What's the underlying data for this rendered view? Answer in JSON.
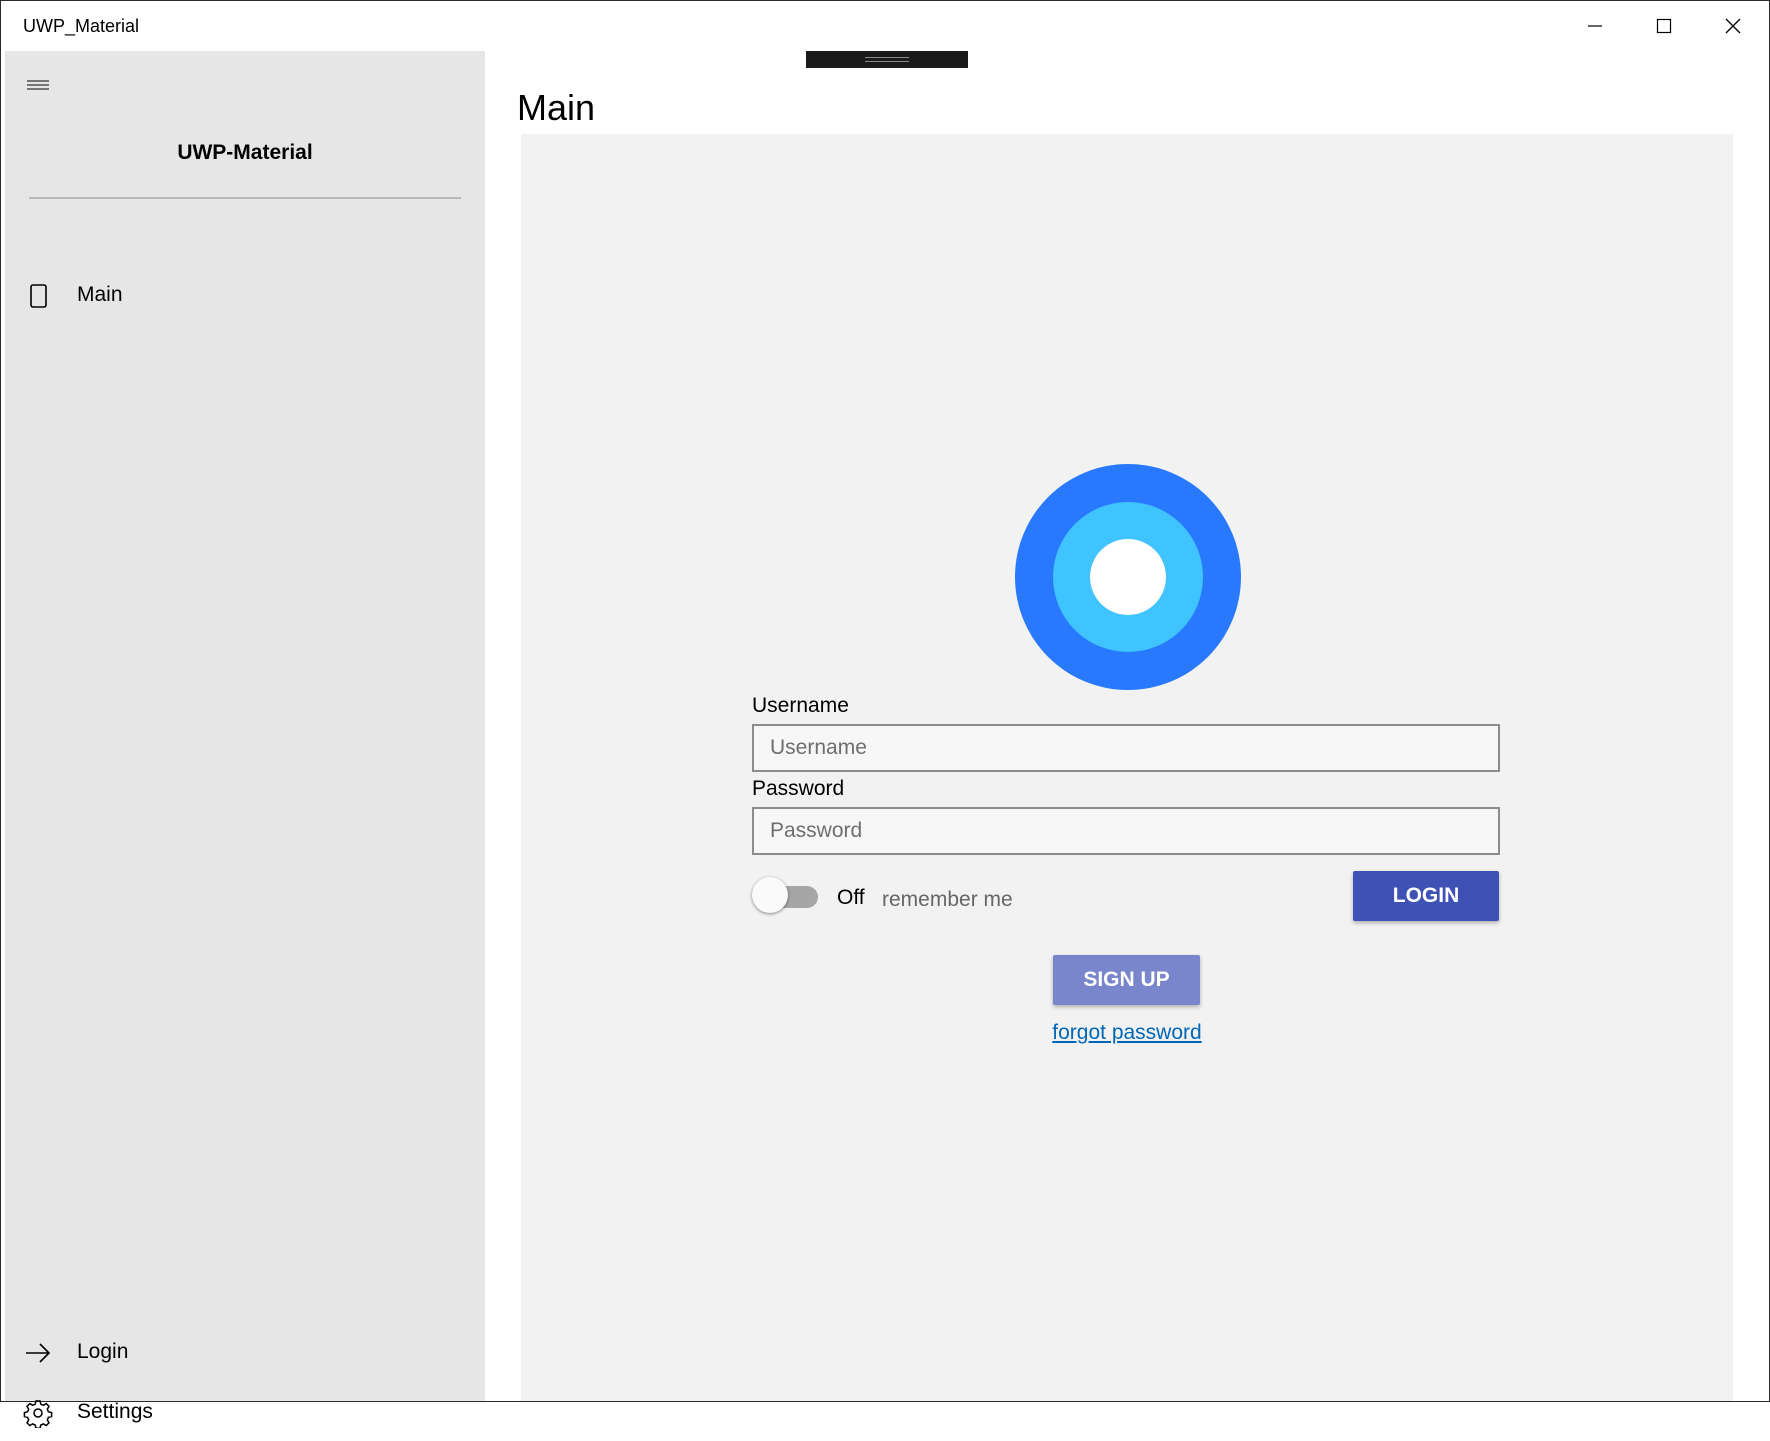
{
  "window": {
    "title": "UWP_Material",
    "minimize_icon": "minimize-icon",
    "maximize_icon": "maximize-icon",
    "close_icon": "close-icon"
  },
  "sidebar": {
    "menu_icon": "hamburger-menu-icon",
    "brand": "UWP-Material",
    "items": [
      {
        "label": "Main",
        "icon": "page-icon"
      }
    ],
    "footer_items": [
      {
        "label": "Login",
        "icon": "arrow-right-icon"
      },
      {
        "label": "Settings",
        "icon": "gear-icon"
      }
    ]
  },
  "page": {
    "title": "Main"
  },
  "login_form": {
    "logo_colors": {
      "outer": "#2979ff",
      "middle": "#40c4ff",
      "inner": "#ffffff"
    },
    "username_label": "Username",
    "username_placeholder": "Username",
    "username_value": "",
    "password_label": "Password",
    "password_placeholder": "Password",
    "password_value": "",
    "remember_toggle_state": "Off",
    "remember_label": "remember me",
    "login_button": "LOGIN",
    "signup_button": "SIGN UP",
    "forgot_link": "forgot password"
  },
  "colors": {
    "sidebar_bg": "#e6e6e6",
    "panel_bg": "#f2f2f2",
    "login_button": "#3f51b5",
    "signup_button": "#7986cb",
    "link": "#0067b8"
  }
}
